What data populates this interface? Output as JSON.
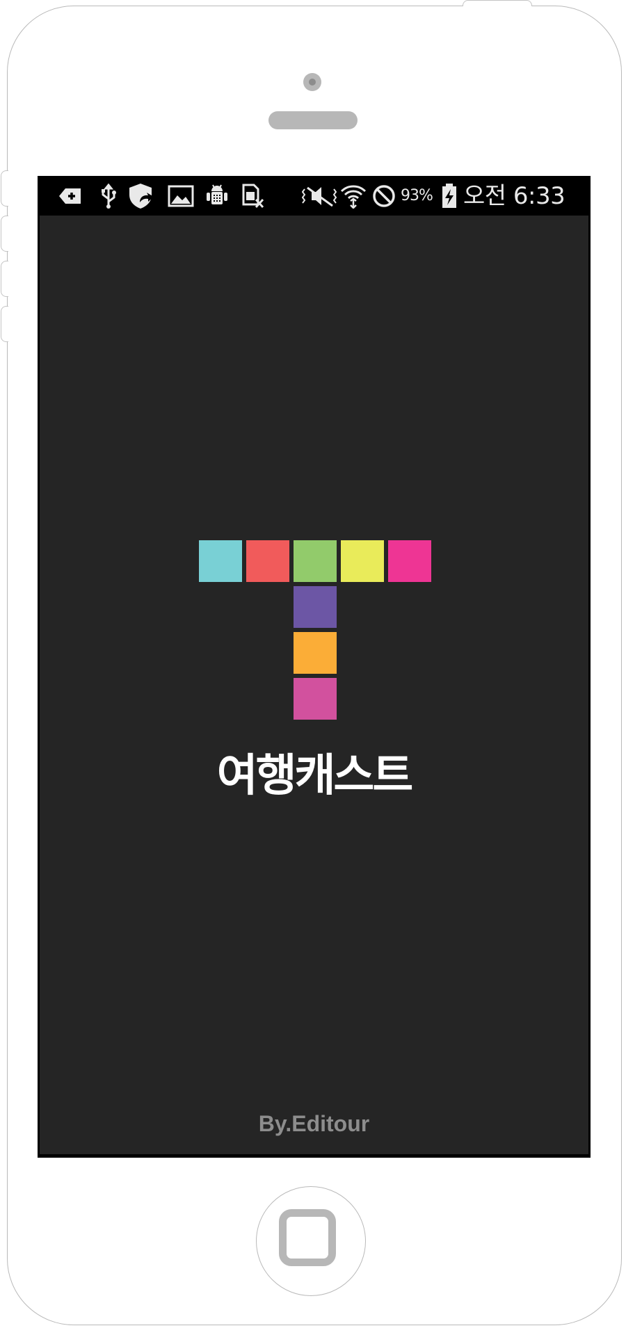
{
  "status_bar": {
    "left_icons": [
      "add-icon",
      "usb-icon",
      "shield-icon",
      "image-icon",
      "android-debug-icon",
      "no-sim-icon"
    ],
    "right_icons": [
      "vibrate-icon",
      "wifi-icon",
      "blocked-icon"
    ],
    "battery_percent": "93%",
    "battery_icon": "battery-charging-icon",
    "time": "오전 6:33"
  },
  "splash": {
    "logo_tiles": [
      {
        "name": "tile-cyan",
        "color": "#79d0d5"
      },
      {
        "name": "tile-red",
        "color": "#f15b5b"
      },
      {
        "name": "tile-green",
        "color": "#92cb6b"
      },
      {
        "name": "tile-yellow",
        "color": "#e9eb5a"
      },
      {
        "name": "tile-pink",
        "color": "#ee3594"
      },
      {
        "name": "tile-purple",
        "color": "#6c56a5"
      },
      {
        "name": "tile-orange",
        "color": "#fbad37"
      },
      {
        "name": "tile-magenta",
        "color": "#d2519e"
      }
    ],
    "app_name": "여행캐스트",
    "credit": "By.Editour",
    "background_color": "#252525"
  }
}
